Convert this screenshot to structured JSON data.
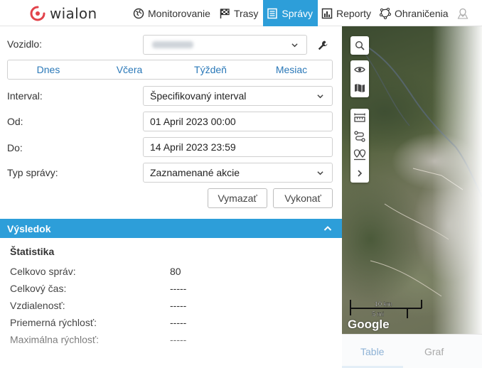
{
  "app": {
    "logo_text": "wialon"
  },
  "nav": [
    {
      "label": "Monitorovanie",
      "icon": "globe-icon"
    },
    {
      "label": "Trasy",
      "icon": "flag-icon"
    },
    {
      "label": "Správy",
      "icon": "list-icon",
      "active": true
    },
    {
      "label": "Reporty",
      "icon": "chart-icon"
    },
    {
      "label": "Ohraničenia",
      "icon": "geofence-icon"
    }
  ],
  "form": {
    "vehicle_label": "Vozidlo:",
    "periods": [
      "Dnes",
      "Včera",
      "Týždeň",
      "Mesiac"
    ],
    "interval_label": "Interval:",
    "interval_value": "Špecifikovaný interval",
    "from_label": "Od:",
    "from_value": "01 April 2023 00:00",
    "to_label": "Do:",
    "to_value": "14 April 2023 23:59",
    "type_label": "Typ správy:",
    "type_value": "Zaznamenané akcie",
    "clear_button": "Vymazať",
    "execute_button": "Vykonať"
  },
  "result": {
    "header": "Výsledok",
    "stats_title": "Štatistika",
    "stats": [
      {
        "label": "Celkovo správ:",
        "value": "80"
      },
      {
        "label": "Celkový čas:",
        "value": "-----"
      },
      {
        "label": "Vzdialenosť:",
        "value": "-----"
      },
      {
        "label": "Priemerná rýchlosť:",
        "value": "-----"
      },
      {
        "label": "Maximálna rýchlosť:",
        "value": "-----"
      }
    ]
  },
  "map": {
    "scale_km": "10 km",
    "scale_mi": "5 mi",
    "attribution": "Google"
  },
  "bottom_tabs": {
    "table": "Table",
    "graph": "Graf"
  },
  "colors": {
    "accent": "#2d9ed9",
    "link": "#2a78b8"
  }
}
